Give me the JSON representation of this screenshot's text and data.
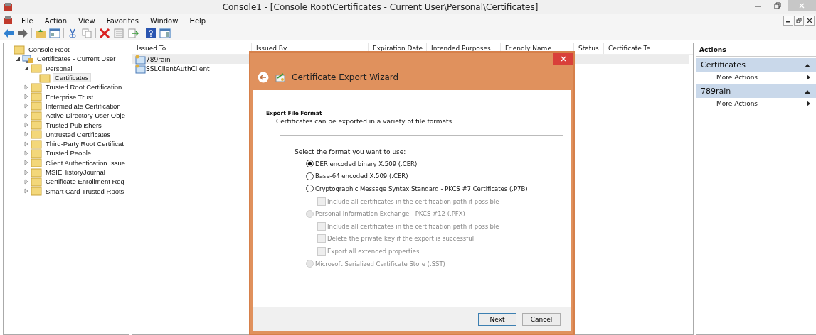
{
  "window": {
    "title": "Console1 - [Console Root\\Certificates - Current User\\Personal\\Certificates]"
  },
  "menu": [
    "File",
    "Action",
    "View",
    "Favorites",
    "Window",
    "Help"
  ],
  "tree": [
    {
      "label": "Console Root",
      "selected": false,
      "children": [
        {
          "label": "Certificates - Current User",
          "expanded": true,
          "selected": false,
          "children": [
            {
              "label": "Personal",
              "expanded": true,
              "selected": false,
              "children": [
                {
                  "label": "Certificates",
                  "selected": true
                }
              ]
            },
            {
              "label": "Trusted Root Certification",
              "expanded": false,
              "selected": false
            },
            {
              "label": "Enterprise Trust",
              "expanded": false,
              "selected": false
            },
            {
              "label": "Intermediate Certification",
              "expanded": false,
              "selected": false
            },
            {
              "label": "Active Directory User Obje",
              "expanded": false,
              "selected": false
            },
            {
              "label": "Trusted Publishers",
              "expanded": false,
              "selected": false
            },
            {
              "label": "Untrusted Certificates",
              "expanded": false,
              "selected": false
            },
            {
              "label": "Third-Party Root Certificat",
              "expanded": false,
              "selected": false
            },
            {
              "label": "Trusted People",
              "expanded": false,
              "selected": false
            },
            {
              "label": "Client Authentication Issue",
              "expanded": false,
              "selected": false
            },
            {
              "label": "MSIEHistoryJournal",
              "expanded": false,
              "selected": false
            },
            {
              "label": "Certificate Enrollment Req",
              "expanded": false,
              "selected": false
            },
            {
              "label": "Smart Card Trusted Roots",
              "expanded": false,
              "selected": false
            }
          ]
        }
      ]
    }
  ],
  "table": {
    "columns": [
      "Issued To",
      "Issued By",
      "Expiration Date",
      "Intended Purposes",
      "Friendly Name",
      "Status",
      "Certificate Te..."
    ],
    "rows": [
      {
        "issued_to": "789rain",
        "selected": true
      },
      {
        "issued_to": "SSLClientAuthClient",
        "selected": false
      }
    ]
  },
  "actions": {
    "title": "Actions",
    "sections": [
      {
        "heading": "Certificates",
        "items": [
          "More Actions"
        ]
      },
      {
        "heading": "789rain",
        "items": [
          "More Actions"
        ]
      }
    ]
  },
  "dialog": {
    "title": "Certificate Export Wizard",
    "heading": "Export File Format",
    "subheading": "Certificates can be exported in a variety of file formats.",
    "prompt": "Select the format you want to use:",
    "options": [
      {
        "kind": "radio",
        "label": "DER encoded binary X.509 (.CER)",
        "selected": true,
        "disabled": false
      },
      {
        "kind": "radio",
        "label": "Base-64 encoded X.509 (.CER)",
        "selected": false,
        "disabled": false
      },
      {
        "kind": "radio",
        "label": "Cryptographic Message Syntax Standard - PKCS #7 Certificates (.P7B)",
        "selected": false,
        "disabled": false,
        "children": [
          {
            "kind": "checkbox",
            "label": "Include all certificates in the certification path if possible",
            "checked": false,
            "disabled": true
          }
        ]
      },
      {
        "kind": "radio",
        "label": "Personal Information Exchange - PKCS #12 (.PFX)",
        "selected": false,
        "disabled": true,
        "children": [
          {
            "kind": "checkbox",
            "label": "Include all certificates in the certification path if possible",
            "checked": false,
            "disabled": true
          },
          {
            "kind": "checkbox",
            "label": "Delete the private key if the export is successful",
            "checked": false,
            "disabled": true
          },
          {
            "kind": "checkbox",
            "label": "Export all extended properties",
            "checked": false,
            "disabled": true
          }
        ]
      },
      {
        "kind": "radio",
        "label": "Microsoft Serialized Certificate Store (.SST)",
        "selected": false,
        "disabled": true
      }
    ],
    "buttons": [
      "Next",
      "Cancel"
    ]
  }
}
